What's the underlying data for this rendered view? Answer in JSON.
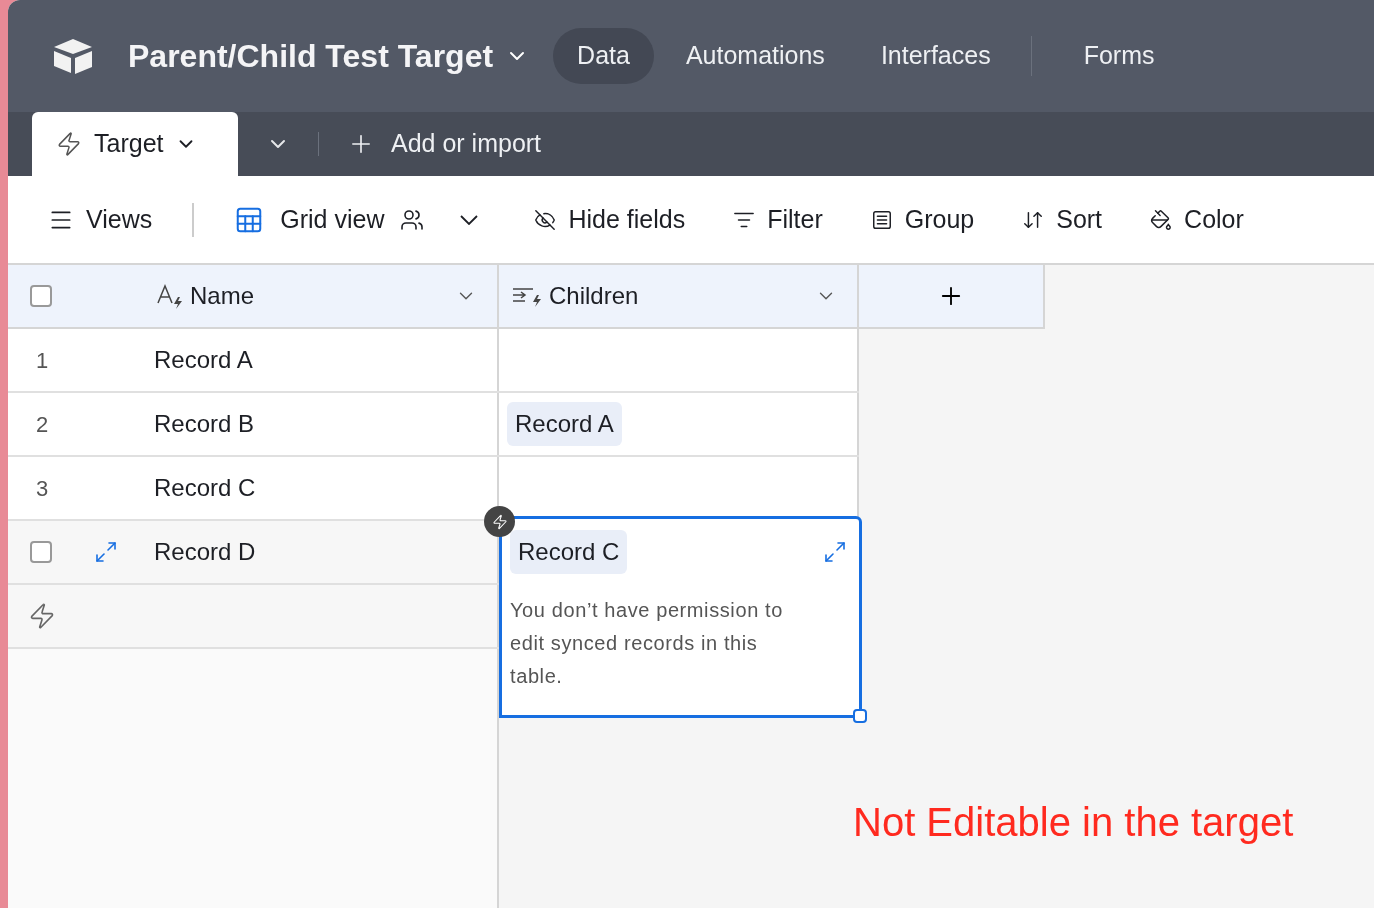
{
  "base": {
    "title": "Parent/Child Test Target"
  },
  "nav": [
    {
      "label": "Data",
      "selected": true
    },
    {
      "label": "Automations",
      "selected": false
    },
    {
      "label": "Interfaces",
      "selected": false
    },
    {
      "label": "Forms",
      "selected": false
    }
  ],
  "table_tab": {
    "label": "Target"
  },
  "add_import": "Add or import",
  "toolbar": {
    "views": "Views",
    "view_name": "Grid view",
    "items": [
      {
        "kind": "hide",
        "label": "Hide fields"
      },
      {
        "kind": "filter",
        "label": "Filter"
      },
      {
        "kind": "group",
        "label": "Group"
      },
      {
        "kind": "sort",
        "label": "Sort"
      },
      {
        "kind": "color",
        "label": "Color"
      }
    ]
  },
  "select_all": {
    "checked": false
  },
  "columns": [
    {
      "kind": "text",
      "label": "Name"
    },
    {
      "kind": "link",
      "label": "Children"
    }
  ],
  "rows": [
    {
      "number": "1",
      "name": "Record A",
      "children": [],
      "hovered": false
    },
    {
      "number": "2",
      "name": "Record B",
      "children": [
        "Record A"
      ],
      "hovered": false
    },
    {
      "number": "3",
      "name": "Record C",
      "children": [],
      "hovered": false
    },
    {
      "name": "Record D",
      "children": [],
      "hovered": true,
      "checked": false
    }
  ],
  "expanded_cell": {
    "children": [
      "Record C"
    ],
    "message": "You don’t have permission to edit synced records in this table."
  },
  "annotation": "Not Editable in the target"
}
